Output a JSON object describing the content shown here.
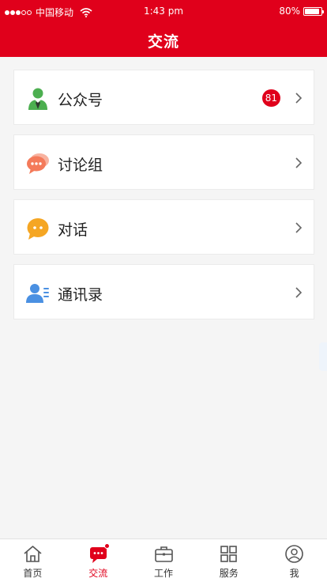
{
  "status_bar": {
    "carrier": "中国移动",
    "time": "1:43 pm",
    "battery": "80%"
  },
  "nav": {
    "title": "交流"
  },
  "menu": {
    "items": [
      {
        "label": "公众号",
        "badge": "81",
        "icon": "official-account-person-icon"
      },
      {
        "label": "讨论组",
        "icon": "discussion-group-chat-bubbles-icon"
      },
      {
        "label": "对话",
        "icon": "dialog-chat-bubble-icon"
      },
      {
        "label": "通讯录",
        "icon": "contacts-person-list-icon"
      }
    ]
  },
  "tab_bar": {
    "tabs": [
      {
        "label": "首页",
        "icon": "home-icon"
      },
      {
        "label": "交流",
        "icon": "chat-icon",
        "active": true
      },
      {
        "label": "工作",
        "icon": "briefcase-icon"
      },
      {
        "label": "服务",
        "icon": "grid-icon"
      },
      {
        "label": "我",
        "icon": "user-circle-icon"
      }
    ]
  },
  "colors": {
    "brand": "#e0001b",
    "background": "#f5f5f5",
    "card": "#ffffff",
    "green_icon": "#4caf50",
    "coral_icon": "#f47a5a",
    "orange_icon": "#f5a623",
    "blue_icon": "#4a90e2"
  }
}
